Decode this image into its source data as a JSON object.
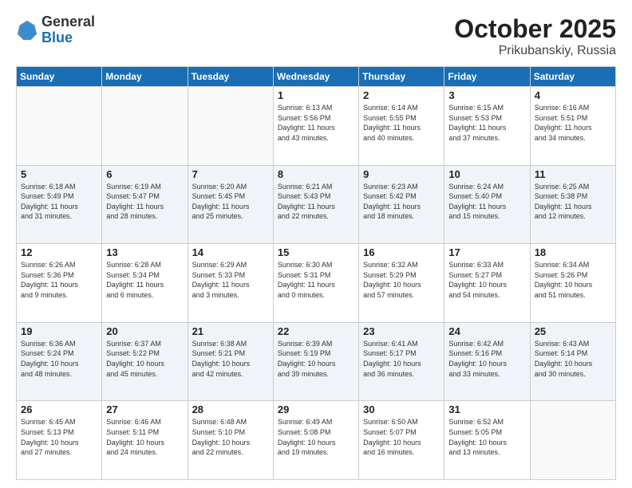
{
  "header": {
    "logo": {
      "general": "General",
      "blue": "Blue"
    },
    "title": "October 2025",
    "subtitle": "Prikubanskiy, Russia"
  },
  "calendar": {
    "days_of_week": [
      "Sunday",
      "Monday",
      "Tuesday",
      "Wednesday",
      "Thursday",
      "Friday",
      "Saturday"
    ],
    "weeks": [
      {
        "alt": false,
        "days": [
          {
            "num": "",
            "info": ""
          },
          {
            "num": "",
            "info": ""
          },
          {
            "num": "",
            "info": ""
          },
          {
            "num": "1",
            "info": "Sunrise: 6:13 AM\nSunset: 5:56 PM\nDaylight: 11 hours\nand 43 minutes."
          },
          {
            "num": "2",
            "info": "Sunrise: 6:14 AM\nSunset: 5:55 PM\nDaylight: 11 hours\nand 40 minutes."
          },
          {
            "num": "3",
            "info": "Sunrise: 6:15 AM\nSunset: 5:53 PM\nDaylight: 11 hours\nand 37 minutes."
          },
          {
            "num": "4",
            "info": "Sunrise: 6:16 AM\nSunset: 5:51 PM\nDaylight: 11 hours\nand 34 minutes."
          }
        ]
      },
      {
        "alt": true,
        "days": [
          {
            "num": "5",
            "info": "Sunrise: 6:18 AM\nSunset: 5:49 PM\nDaylight: 11 hours\nand 31 minutes."
          },
          {
            "num": "6",
            "info": "Sunrise: 6:19 AM\nSunset: 5:47 PM\nDaylight: 11 hours\nand 28 minutes."
          },
          {
            "num": "7",
            "info": "Sunrise: 6:20 AM\nSunset: 5:45 PM\nDaylight: 11 hours\nand 25 minutes."
          },
          {
            "num": "8",
            "info": "Sunrise: 6:21 AM\nSunset: 5:43 PM\nDaylight: 11 hours\nand 22 minutes."
          },
          {
            "num": "9",
            "info": "Sunrise: 6:23 AM\nSunset: 5:42 PM\nDaylight: 11 hours\nand 18 minutes."
          },
          {
            "num": "10",
            "info": "Sunrise: 6:24 AM\nSunset: 5:40 PM\nDaylight: 11 hours\nand 15 minutes."
          },
          {
            "num": "11",
            "info": "Sunrise: 6:25 AM\nSunset: 5:38 PM\nDaylight: 11 hours\nand 12 minutes."
          }
        ]
      },
      {
        "alt": false,
        "days": [
          {
            "num": "12",
            "info": "Sunrise: 6:26 AM\nSunset: 5:36 PM\nDaylight: 11 hours\nand 9 minutes."
          },
          {
            "num": "13",
            "info": "Sunrise: 6:28 AM\nSunset: 5:34 PM\nDaylight: 11 hours\nand 6 minutes."
          },
          {
            "num": "14",
            "info": "Sunrise: 6:29 AM\nSunset: 5:33 PM\nDaylight: 11 hours\nand 3 minutes."
          },
          {
            "num": "15",
            "info": "Sunrise: 6:30 AM\nSunset: 5:31 PM\nDaylight: 11 hours\nand 0 minutes."
          },
          {
            "num": "16",
            "info": "Sunrise: 6:32 AM\nSunset: 5:29 PM\nDaylight: 10 hours\nand 57 minutes."
          },
          {
            "num": "17",
            "info": "Sunrise: 6:33 AM\nSunset: 5:27 PM\nDaylight: 10 hours\nand 54 minutes."
          },
          {
            "num": "18",
            "info": "Sunrise: 6:34 AM\nSunset: 5:26 PM\nDaylight: 10 hours\nand 51 minutes."
          }
        ]
      },
      {
        "alt": true,
        "days": [
          {
            "num": "19",
            "info": "Sunrise: 6:36 AM\nSunset: 5:24 PM\nDaylight: 10 hours\nand 48 minutes."
          },
          {
            "num": "20",
            "info": "Sunrise: 6:37 AM\nSunset: 5:22 PM\nDaylight: 10 hours\nand 45 minutes."
          },
          {
            "num": "21",
            "info": "Sunrise: 6:38 AM\nSunset: 5:21 PM\nDaylight: 10 hours\nand 42 minutes."
          },
          {
            "num": "22",
            "info": "Sunrise: 6:39 AM\nSunset: 5:19 PM\nDaylight: 10 hours\nand 39 minutes."
          },
          {
            "num": "23",
            "info": "Sunrise: 6:41 AM\nSunset: 5:17 PM\nDaylight: 10 hours\nand 36 minutes."
          },
          {
            "num": "24",
            "info": "Sunrise: 6:42 AM\nSunset: 5:16 PM\nDaylight: 10 hours\nand 33 minutes."
          },
          {
            "num": "25",
            "info": "Sunrise: 6:43 AM\nSunset: 5:14 PM\nDaylight: 10 hours\nand 30 minutes."
          }
        ]
      },
      {
        "alt": false,
        "days": [
          {
            "num": "26",
            "info": "Sunrise: 6:45 AM\nSunset: 5:13 PM\nDaylight: 10 hours\nand 27 minutes."
          },
          {
            "num": "27",
            "info": "Sunrise: 6:46 AM\nSunset: 5:11 PM\nDaylight: 10 hours\nand 24 minutes."
          },
          {
            "num": "28",
            "info": "Sunrise: 6:48 AM\nSunset: 5:10 PM\nDaylight: 10 hours\nand 22 minutes."
          },
          {
            "num": "29",
            "info": "Sunrise: 6:49 AM\nSunset: 5:08 PM\nDaylight: 10 hours\nand 19 minutes."
          },
          {
            "num": "30",
            "info": "Sunrise: 6:50 AM\nSunset: 5:07 PM\nDaylight: 10 hours\nand 16 minutes."
          },
          {
            "num": "31",
            "info": "Sunrise: 6:52 AM\nSunset: 5:05 PM\nDaylight: 10 hours\nand 13 minutes."
          },
          {
            "num": "",
            "info": ""
          }
        ]
      }
    ]
  }
}
